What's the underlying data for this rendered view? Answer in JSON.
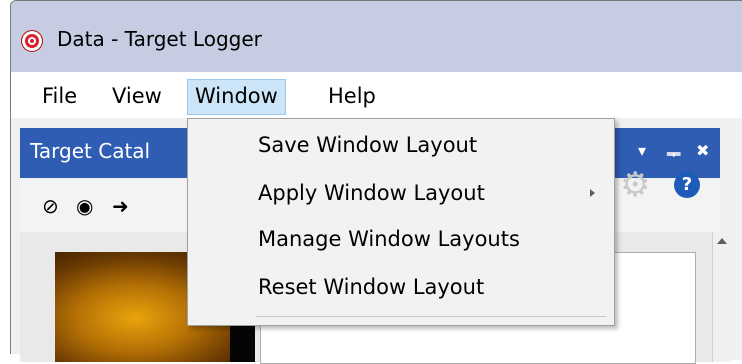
{
  "window": {
    "title": "Data - Target Logger"
  },
  "menubar": {
    "items": [
      {
        "label": "File"
      },
      {
        "label": "View"
      },
      {
        "label": "Window"
      },
      {
        "label": "Help"
      }
    ],
    "active": "Window"
  },
  "dropdown": {
    "items": [
      {
        "label": "Save Window Layout",
        "has_submenu": false
      },
      {
        "label": "Apply Window Layout",
        "has_submenu": true
      },
      {
        "label": "Manage Window Layouts",
        "has_submenu": false
      },
      {
        "label": "Reset Window Layout",
        "has_submenu": false
      }
    ]
  },
  "panel": {
    "title": "Target Catalog",
    "title_visible": "Target Catal",
    "controls": {
      "dropdown_glyph": "▾",
      "pin_glyph": "ᆍ",
      "close_glyph": "✖"
    },
    "toolbar_icons": [
      "eye-hidden-icon",
      "eye-icon",
      "export-arrow-icon",
      "gear-icon",
      "help-icon"
    ]
  },
  "colors": {
    "title_bar": "#c6cde2",
    "panel_header": "#2f5db3",
    "menu_highlight": "#cce4f7",
    "help_blue": "#1e5bb8"
  }
}
